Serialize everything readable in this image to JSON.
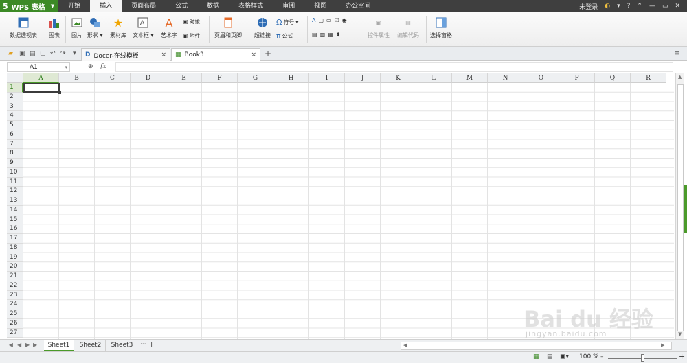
{
  "title_bar": {
    "app_logo": "5",
    "app_name": "WPS 表格",
    "menu_tabs": [
      "开始",
      "插入",
      "页面布局",
      "公式",
      "数据",
      "表格样式",
      "审阅",
      "视图",
      "办公空间"
    ],
    "active_tab": "插入",
    "login": "未登录",
    "help": "?",
    "window_controls": [
      "minimize-icon",
      "restore-icon",
      "close-icon"
    ]
  },
  "ribbon": {
    "pivot": "数据透视表",
    "chart": "图表",
    "picture": "图片",
    "shape": "形状",
    "material": "素材库",
    "textbox": "文本框",
    "wordart": "艺术字",
    "object": "对象",
    "attachment": "附件",
    "header_footer": "页眉和页脚",
    "hyperlink": "超链接",
    "symbol": "符号",
    "formula": "公式",
    "control_props": "控件属性",
    "edit_code": "编辑代码",
    "select_pane": "选择窗格",
    "colors": {
      "accent_green": "#3c8a26",
      "chart_red": "#d9534f",
      "chart_blue": "#2f6db5",
      "star": "#f0a500",
      "wordart": "#e56b2a"
    }
  },
  "tabs": {
    "docer": "Docer-在线模板",
    "book": "Book3",
    "close": "×",
    "new": "+"
  },
  "formula_bar": {
    "cell_ref": "A1",
    "fx": "fx"
  },
  "sheet": {
    "columns": [
      "A",
      "B",
      "C",
      "D",
      "E",
      "F",
      "G",
      "H",
      "I",
      "J",
      "K",
      "L",
      "M",
      "N",
      "O",
      "P",
      "Q",
      "R"
    ],
    "rows": [
      "1",
      "2",
      "3",
      "4",
      "5",
      "6",
      "7",
      "8",
      "9",
      "10",
      "11",
      "12",
      "13",
      "14",
      "15",
      "16",
      "17",
      "18",
      "19",
      "20",
      "21",
      "22",
      "23",
      "24",
      "25",
      "26",
      "27"
    ],
    "selected_cell": "A1"
  },
  "sheet_tabs": {
    "tabs": [
      "Sheet1",
      "Sheet2",
      "Sheet3"
    ],
    "active": "Sheet1",
    "more": "···",
    "add": "+"
  },
  "status_bar": {
    "zoom": "100 %",
    "zoom_out": "–",
    "zoom_in": "+",
    "zoom_level": 1.0
  },
  "watermark": {
    "text": "Bai du 经验",
    "url": "jingyan.baidu.com"
  }
}
